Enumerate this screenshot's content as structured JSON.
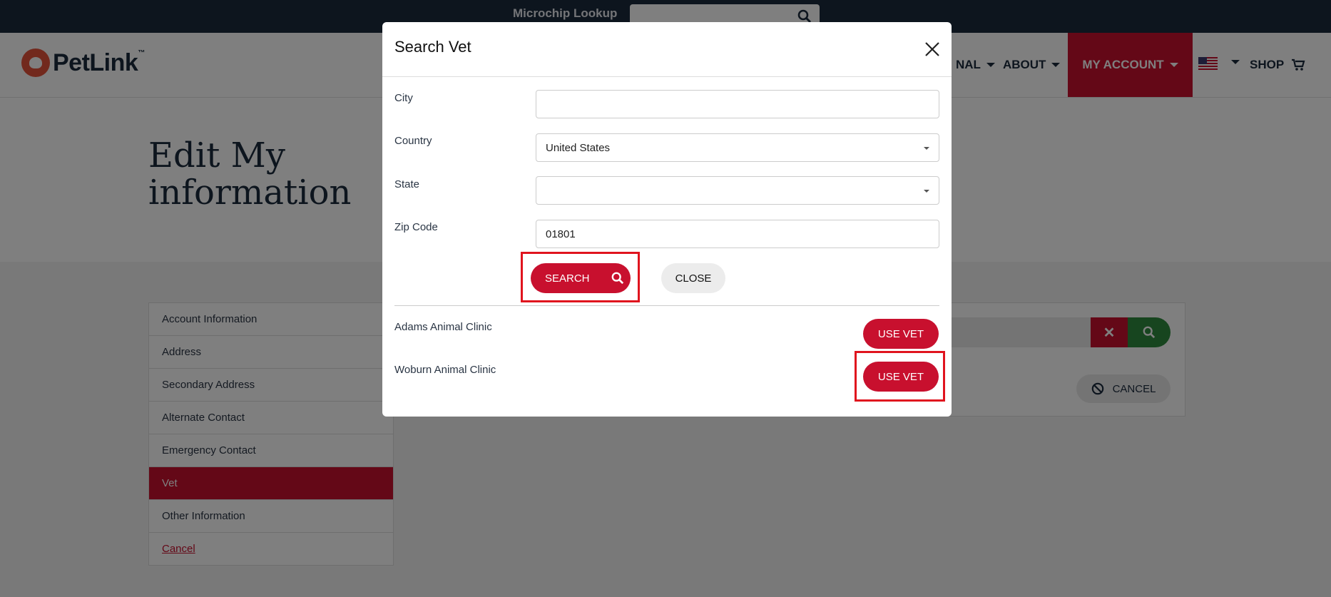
{
  "topbar": {
    "microchip_label": "Microchip Lookup",
    "microchip_placeholder": ""
  },
  "header": {
    "brand": "PetLink",
    "brand_tm": "™",
    "nav": [
      {
        "label": "NAL"
      },
      {
        "label": "ABOUT"
      }
    ],
    "my_account": "MY ACCOUNT",
    "shop": "SHOP"
  },
  "page": {
    "title_line1": "Edit My",
    "title_line2": "information",
    "sidenav": [
      {
        "label": "Account Information"
      },
      {
        "label": "Address"
      },
      {
        "label": "Secondary Address"
      },
      {
        "label": "Alternate Contact"
      },
      {
        "label": "Emergency Contact"
      },
      {
        "label": "Vet"
      },
      {
        "label": "Other Information"
      },
      {
        "label": "Cancel"
      }
    ],
    "cancel_button": "CANCEL"
  },
  "modal": {
    "title": "Search Vet",
    "fields": {
      "city": {
        "label": "City",
        "value": ""
      },
      "country": {
        "label": "Country",
        "value": "United States"
      },
      "state": {
        "label": "State",
        "value": ""
      },
      "zip": {
        "label": "Zip Code",
        "value": "01801"
      }
    },
    "search_button": "SEARCH",
    "close_button": "CLOSE",
    "results": [
      {
        "name": "Adams Animal Clinic",
        "action": "USE VET"
      },
      {
        "name": "Woburn Animal Clinic",
        "action": "USE VET"
      }
    ]
  },
  "colors": {
    "brand_red": "#c8102e",
    "navy": "#1b2a3d",
    "green": "#2f8a3e",
    "highlight": "#e0141e"
  }
}
